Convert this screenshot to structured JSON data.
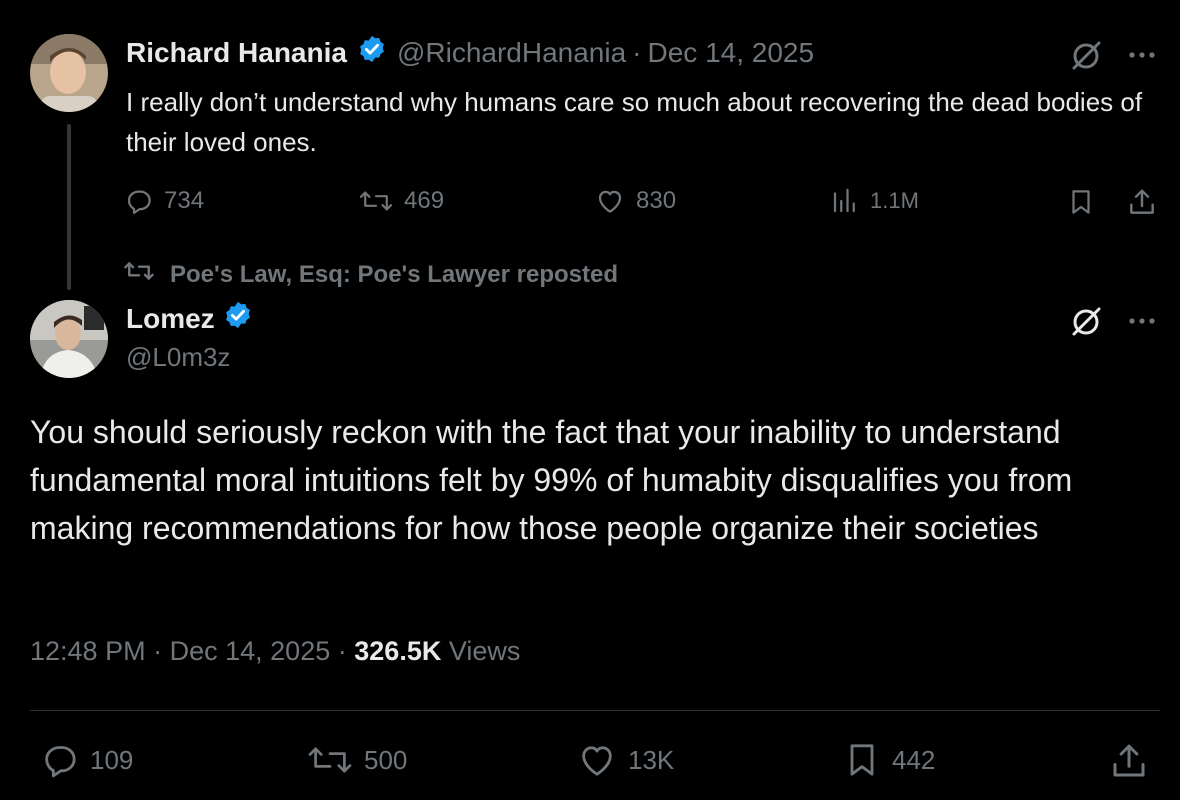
{
  "original_tweet": {
    "author_name": "Richard Hanania",
    "handle": "@RichardHanania",
    "separator": "·",
    "date": "Dec 14, 2025",
    "text": "I really don’t understand why humans care so much about recovering the dead bodies of their loved ones.",
    "replies": "734",
    "reposts": "469",
    "likes": "830",
    "views": "1.1M"
  },
  "repost_note": "Poe's Law, Esq: Poe's Lawyer reposted",
  "reply_tweet": {
    "author_name": "Lomez",
    "handle": "@L0m3z",
    "text": "You should seriously reckon with the fact that your inability to understand fundamental moral intuitions felt by 99% of humabity disqualifies you from making  recommendations for how those people organize their societies",
    "time": "12:48 PM",
    "date": "Dec 14, 2025",
    "views_count": "326.5K",
    "views_label": "Views",
    "separator": "·",
    "replies": "109",
    "reposts": "500",
    "likes": "13K",
    "bookmarks": "442"
  },
  "icons": {
    "reply": "reply-icon",
    "repost": "repost-icon",
    "like": "heart-icon",
    "views": "views-icon",
    "bookmark": "bookmark-icon",
    "share": "share-icon",
    "grok": "grok-icon",
    "more": "more-icon",
    "verified": "verified-badge-icon"
  },
  "colors": {
    "background": "#000000",
    "text": "#e7e9ea",
    "muted": "#71767b",
    "verified": "#1d9bf0",
    "divider": "#2f3336"
  }
}
